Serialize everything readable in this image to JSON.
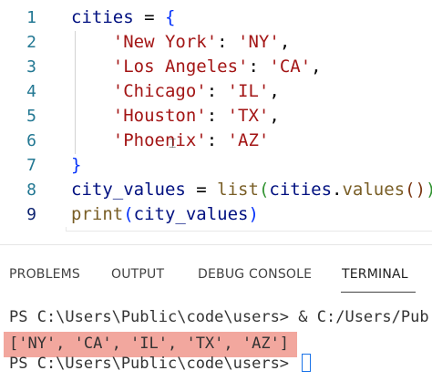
{
  "editor": {
    "lines": [
      {
        "num": "1",
        "tokens": [
          [
            "var",
            "cities"
          ],
          [
            "op",
            " = "
          ],
          [
            "brace",
            "{"
          ]
        ]
      },
      {
        "num": "2",
        "tokens": [
          [
            "op",
            "    "
          ],
          [
            "str",
            "'New York'"
          ],
          [
            "op",
            ": "
          ],
          [
            "str",
            "'NY'"
          ],
          [
            "op",
            ","
          ]
        ]
      },
      {
        "num": "3",
        "tokens": [
          [
            "op",
            "    "
          ],
          [
            "str",
            "'Los Angeles'"
          ],
          [
            "op",
            ": "
          ],
          [
            "str",
            "'CA'"
          ],
          [
            "op",
            ","
          ]
        ]
      },
      {
        "num": "4",
        "tokens": [
          [
            "op",
            "    "
          ],
          [
            "str",
            "'Chicago'"
          ],
          [
            "op",
            ": "
          ],
          [
            "str",
            "'IL'"
          ],
          [
            "op",
            ","
          ]
        ]
      },
      {
        "num": "5",
        "tokens": [
          [
            "op",
            "    "
          ],
          [
            "str",
            "'Houston'"
          ],
          [
            "op",
            ": "
          ],
          [
            "str",
            "'TX'"
          ],
          [
            "op",
            ","
          ]
        ]
      },
      {
        "num": "6",
        "tokens": [
          [
            "op",
            "    "
          ],
          [
            "str",
            "'Phoenix'"
          ],
          [
            "op",
            ": "
          ],
          [
            "str",
            "'AZ'"
          ]
        ]
      },
      {
        "num": "7",
        "tokens": [
          [
            "brace",
            "}"
          ]
        ]
      },
      {
        "num": "8",
        "tokens": [
          [
            "var",
            "city_values"
          ],
          [
            "op",
            " = "
          ],
          [
            "fn",
            "list"
          ],
          [
            "paren2",
            "("
          ],
          [
            "var",
            "cities"
          ],
          [
            "op",
            "."
          ],
          [
            "fn",
            "values"
          ],
          [
            "paren3",
            "("
          ],
          [
            "paren3",
            ")"
          ],
          [
            "paren2",
            ")"
          ]
        ]
      },
      {
        "num": "9",
        "tokens": [
          [
            "fn",
            "print"
          ],
          [
            "paren1",
            "("
          ],
          [
            "var",
            "city_values"
          ],
          [
            "paren1",
            ")"
          ]
        ]
      }
    ],
    "active_line": "9"
  },
  "panel": {
    "tabs": [
      {
        "label": "PROBLEMS"
      },
      {
        "label": "OUTPUT"
      },
      {
        "label": "DEBUG CONSOLE"
      },
      {
        "label": "TERMINAL",
        "active": true
      }
    ],
    "terminal": {
      "line1": "PS C:\\Users\\Public\\code\\users> & C:/Users/Pub",
      "line2": "['NY', 'CA', 'IL', 'TX', 'AZ']",
      "line3": "PS C:\\Users\\Public\\code\\users> "
    }
  },
  "colors": {
    "line_number": "#237893",
    "string": "#a31515",
    "variable": "#001080",
    "function": "#795e26",
    "highlight": "#f2a79e"
  }
}
